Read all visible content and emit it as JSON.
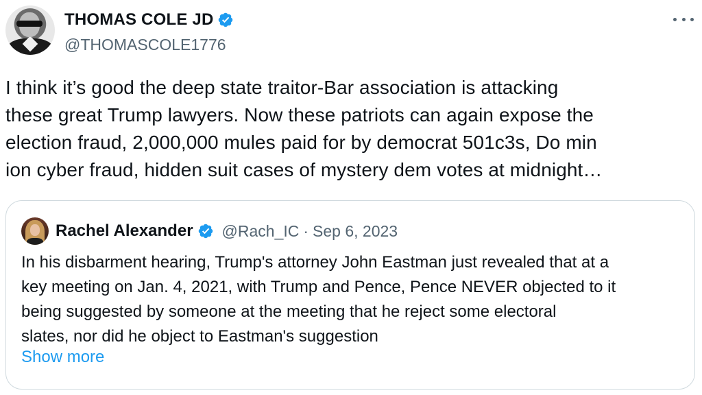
{
  "author": {
    "display_name": "THOMAS COLE JD",
    "handle": "@THOMASCOLE1776",
    "verified": true
  },
  "tweet": {
    "lines": [
      "I think it’s good the deep state traitor-Bar association is attacking",
      "these great Trump lawyers.  Now these patriots can again expose the",
      "election fraud, 2,000,000 mules paid for by democrat 501c3s, Do min",
      "ion cyber fraud, hidden suit cases of mystery dem votes at midnight…"
    ]
  },
  "quoted": {
    "display_name": "Rachel Alexander",
    "handle": "@Rach_IC",
    "separator": "·",
    "date": "Sep 6, 2023",
    "lines": [
      "In his disbarment hearing, Trump's attorney John Eastman just revealed that at a",
      "key meeting on Jan. 4, 2021, with Trump and Pence, Pence NEVER objected to it",
      "being suggested by someone at the meeting that he reject some electoral",
      "slates, nor did he object to Eastman's suggestion"
    ],
    "show_more_label": "Show more"
  },
  "colors": {
    "verified_blue": "#1d9bf0",
    "link_blue": "#1d9bf0",
    "secondary_text": "#536471",
    "border": "#cfd9de"
  },
  "icons": {
    "verified": "verified-badge-icon",
    "more": "more-horizontal-icon"
  }
}
